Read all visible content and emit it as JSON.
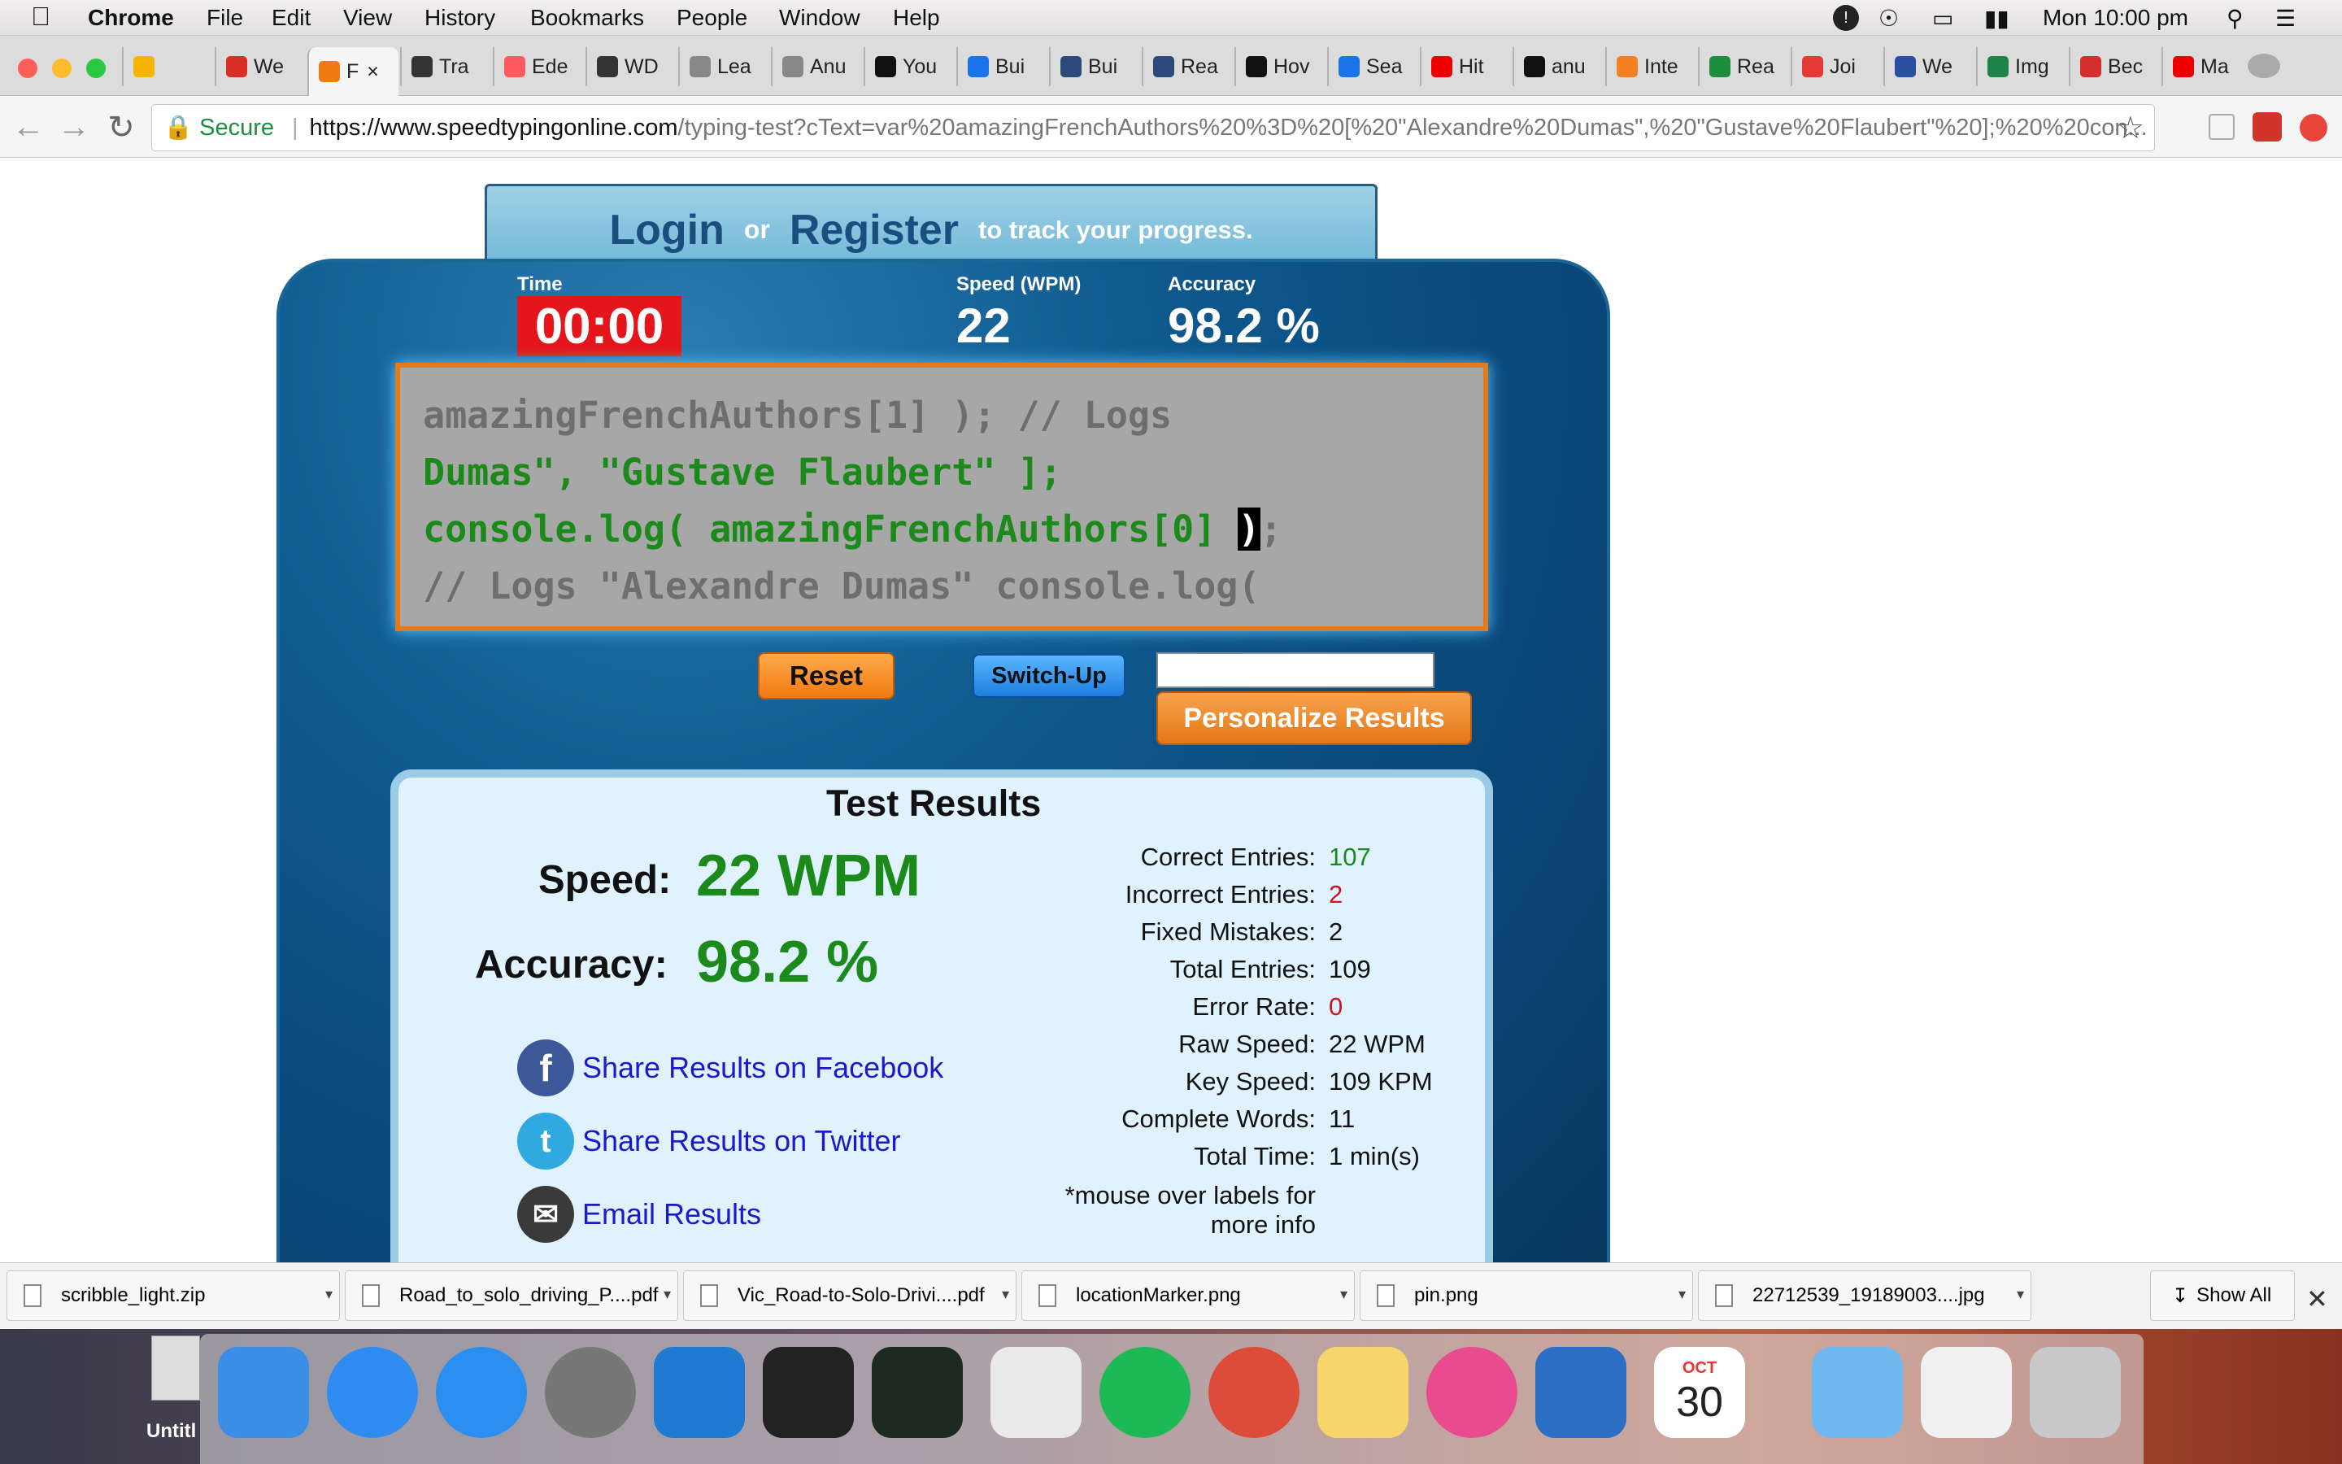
{
  "menubar": {
    "app_name": "Chrome",
    "items": [
      "File",
      "Edit",
      "View",
      "History",
      "Bookmarks",
      "People",
      "Window",
      "Help"
    ],
    "clock": "Mon 10:00 pm"
  },
  "tabs": [
    {
      "label": "",
      "icon": "slides-icon"
    },
    {
      "label": "We",
      "icon": "gmail-icon"
    },
    {
      "label": "F",
      "icon": "speedtyping-icon",
      "active": true
    },
    {
      "label": "Tra",
      "icon": "codepen-icon"
    },
    {
      "label": "Ede",
      "icon": "airbnb-icon"
    },
    {
      "label": "WD",
      "icon": "t-icon"
    },
    {
      "label": "Lea",
      "icon": "doc-icon"
    },
    {
      "label": "Anu",
      "icon": "doc-icon"
    },
    {
      "label": "You",
      "icon": "github-icon"
    },
    {
      "label": "Bui",
      "icon": "p-icon"
    },
    {
      "label": "Bui",
      "icon": "screen-icon"
    },
    {
      "label": "Rea",
      "icon": "screen-icon"
    },
    {
      "label": "Hov",
      "icon": "github-icon"
    },
    {
      "label": "Sea",
      "icon": "info-icon"
    },
    {
      "label": "Hit",
      "icon": "youtube-icon"
    },
    {
      "label": "anu",
      "icon": "github-icon"
    },
    {
      "label": "Inte",
      "icon": "stack-icon"
    },
    {
      "label": "Rea",
      "icon": "phone-icon"
    },
    {
      "label": "Joi",
      "icon": "c-icon"
    },
    {
      "label": "We",
      "icon": "globe-icon"
    },
    {
      "label": "Img",
      "icon": "img-icon"
    },
    {
      "label": "Bec",
      "icon": "ga-icon"
    },
    {
      "label": "Ma",
      "icon": "youtube-icon"
    }
  ],
  "toolbar": {
    "secure_label": "Secure",
    "url_host": "https://www.speedtypingonline.com",
    "url_path": "/typing-test?cText=var%20amazingFrenchAuthors%20%3D%20[%20\"Alexandre%20Dumas\",%20\"Gustave%20Flaubert\"%20];%20%20con..."
  },
  "page": {
    "login": "Login",
    "or": "or",
    "register": "Register",
    "track": "to track your progress.",
    "time_label": "Time",
    "time_value": "00:00",
    "speed_label": "Speed (WPM)",
    "speed_value": "22",
    "accuracy_label": "Accuracy",
    "accuracy_value": "98.2 %",
    "lines": {
      "l1": "amazingFrenchAuthors[1] ); // Logs",
      "l2": "Dumas\", \"Gustave Flaubert\" ];",
      "l3_typed": "console.log( amazingFrenchAuthors[0] ",
      "l3_cursor": ")",
      "l3_rest": ";",
      "l4": "// Logs \"Alexandre Dumas\" console.log("
    },
    "reset_label": "Reset",
    "switchup_label": "Switch-Up",
    "name_input_value": "",
    "personalize_label": "Personalize Results"
  },
  "results": {
    "title": "Test Results",
    "speed_label": "Speed:",
    "speed_value": "22 WPM",
    "accuracy_label": "Accuracy:",
    "accuracy_value": "98.2 %",
    "share_facebook": "Share Results on Facebook",
    "share_twitter": "Share Results on Twitter",
    "email": "Email Results",
    "stats": [
      {
        "label": "Correct Entries:",
        "value": "107",
        "color": "#1b8a1b"
      },
      {
        "label": "Incorrect Entries:",
        "value": "2",
        "color": "#d0121b"
      },
      {
        "label": "Fixed Mistakes:",
        "value": "2",
        "color": "#111111"
      },
      {
        "label": "Total Entries:",
        "value": "109",
        "color": "#111111"
      },
      {
        "label": "Error Rate:",
        "value": "0",
        "color": "#d0121b"
      },
      {
        "label": "Raw Speed:",
        "value": "22 WPM",
        "color": "#111111"
      },
      {
        "label": "Key Speed:",
        "value": "109 KPM",
        "color": "#111111"
      },
      {
        "label": "Complete Words:",
        "value": "11",
        "color": "#111111"
      },
      {
        "label": "Total Time:",
        "value": "1 min(s)",
        "color": "#111111"
      }
    ],
    "mouse_note_1": "*mouse over labels for",
    "mouse_note_2": "more info"
  },
  "downloads": {
    "files": [
      "scribble_light.zip",
      "Road_to_solo_driving_P....pdf",
      "Vic_Road-to-Solo-Drivi....pdf",
      "locationMarker.png",
      "pin.png",
      "22712539_19189003....jpg"
    ],
    "show_all": "Show All"
  },
  "desktop": {
    "label": "Untitl",
    "calendar_month": "OCT",
    "calendar_day": "30"
  },
  "dock": [
    "finder-icon",
    "safari-icon",
    "app-store-icon",
    "system-preferences-icon",
    "vscode-icon",
    "terminal-icon",
    "activity-monitor-icon",
    "textedit-icon",
    "spotify-icon",
    "chrome-icon",
    "notes-icon",
    "itunes-icon",
    "xcode-icon",
    "calendar-icon",
    "folder-icon",
    "document-icon",
    "trash-icon"
  ]
}
